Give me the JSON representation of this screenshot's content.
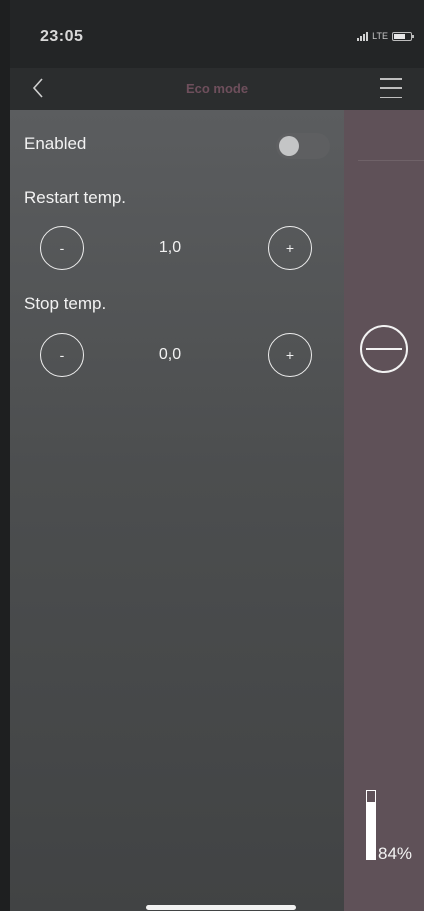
{
  "status_bar": {
    "time": "23:05",
    "network": "LTE"
  },
  "nav": {
    "title": "Eco mode"
  },
  "settings": {
    "enabled": {
      "label": "Enabled",
      "value": false
    },
    "restart": {
      "label": "Restart temp.",
      "value": "1,0",
      "minus": "-",
      "plus": "+"
    },
    "stop": {
      "label": "Stop temp.",
      "value": "0,0",
      "minus": "-",
      "plus": "+"
    }
  },
  "side": {
    "level": 84,
    "level_text": "84%"
  },
  "icons": {
    "back": "chevron-left-icon",
    "menu": "hamburger-menu-icon",
    "remove": "minus-circle-icon"
  },
  "colors": {
    "title_accent": "#6e4f5c",
    "side_panel": "#5f5158",
    "panel": "#4c4e4f"
  }
}
